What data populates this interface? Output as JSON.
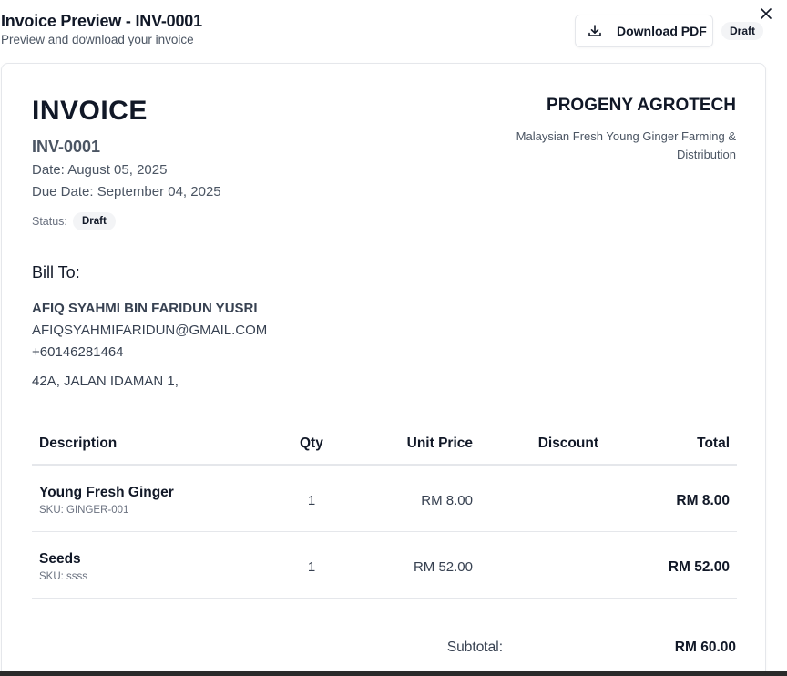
{
  "header": {
    "title": "Invoice Preview - INV-0001",
    "subtitle": "Preview and download your invoice",
    "download_label": "Download PDF",
    "download_icon": "download-icon",
    "status_badge": "Draft",
    "close_icon": "close-icon"
  },
  "invoice": {
    "heading": "INVOICE",
    "number": "INV-0001",
    "date": "Date: August 05, 2025",
    "due_date": "Due Date: September 04, 2025",
    "status_label": "Status:",
    "status": "Draft"
  },
  "company": {
    "name": "PROGENY AGROTECH",
    "tagline": "Malaysian Fresh Young Ginger Farming & Distribution"
  },
  "bill_to": {
    "title": "Bill To:",
    "name": "AFIQ SYAHMI BIN FARIDUN YUSRI",
    "email": "AFIQSYAHMIFARIDUN@GMAIL.COM",
    "phone": "+60146281464",
    "address": "42A, JALAN IDAMAN 1,"
  },
  "table": {
    "headers": {
      "description": "Description",
      "qty": "Qty",
      "unit_price": "Unit Price",
      "discount": "Discount",
      "total": "Total"
    },
    "rows": [
      {
        "name": "Young Fresh Ginger",
        "sku": "SKU: GINGER-001",
        "qty": "1",
        "unit_price": "RM 8.00",
        "discount": "",
        "total": "RM 8.00"
      },
      {
        "name": "Seeds",
        "sku": "SKU: ssss",
        "qty": "1",
        "unit_price": "RM 52.00",
        "discount": "",
        "total": "RM 52.00"
      }
    ]
  },
  "summary": {
    "subtotal_label": "Subtotal:",
    "subtotal_value": "RM 60.00"
  },
  "colors": {
    "text_primary": "#111827",
    "text_secondary": "#4b5563",
    "border": "#e5e7eb",
    "badge_bg": "#f3f4f6"
  }
}
